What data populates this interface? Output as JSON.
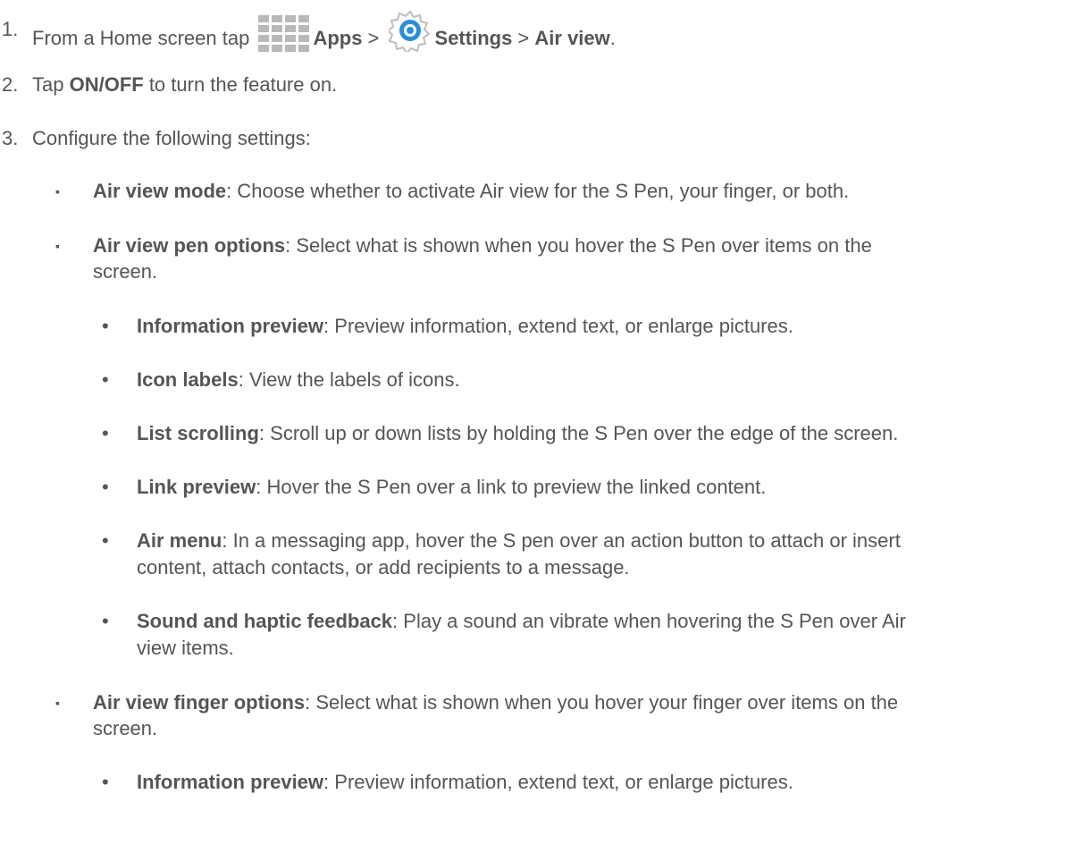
{
  "steps": [
    {
      "num": "1.",
      "p1": "From a Home screen tap ",
      "apps": "Apps",
      "sep1": " > ",
      "settings": "Settings",
      "sep2": " > ",
      "airview": "Air view",
      "end": ".",
      "icons": [
        "apps-grid-icon",
        "settings-gear-icon"
      ]
    },
    {
      "num": "2.",
      "pre": "Tap ",
      "bold": "ON/OFF",
      "post": " to turn the feature on."
    },
    {
      "num": "3.",
      "text": "Configure the following settings:"
    }
  ],
  "settings": [
    {
      "bold": "Air view mode",
      "text": ": Choose whether to activate Air view for the S Pen, your finger, or both."
    },
    {
      "bold": "Air view pen options",
      "text": ": Select what is shown when you hover the S Pen over items on the",
      "cont": "screen."
    },
    {
      "bold": "Air view finger options",
      "text": ": Select what is shown when you hover your finger over items on the",
      "cont": "screen."
    }
  ],
  "pen_options": [
    {
      "bold": "Information preview",
      "text": ": Preview information, extend text, or enlarge pictures."
    },
    {
      "bold": "Icon labels",
      "text": ": View the labels of icons."
    },
    {
      "bold": "List scrolling",
      "text": ": Scroll up or down lists by holding the S Pen over the edge of the screen."
    },
    {
      "bold": "Link preview",
      "text": ": Hover the S Pen over a link to preview the linked content."
    },
    {
      "bold": "Air menu",
      "text": ": In a messaging app, hover the S pen over an action button to attach or insert",
      "cont": "content, attach contacts, or add recipients to a message."
    },
    {
      "bold": "Sound and haptic feedback",
      "text": ": Play a sound an vibrate when hovering the S Pen over Air",
      "cont": "view items."
    }
  ],
  "finger_options": [
    {
      "bold": "Information preview",
      "text": ": Preview information, extend text, or enlarge pictures."
    }
  ],
  "colors": {
    "text": "#555555",
    "icon_grey": "#b9b9b9",
    "icon_blue": "#2a8fd6"
  }
}
